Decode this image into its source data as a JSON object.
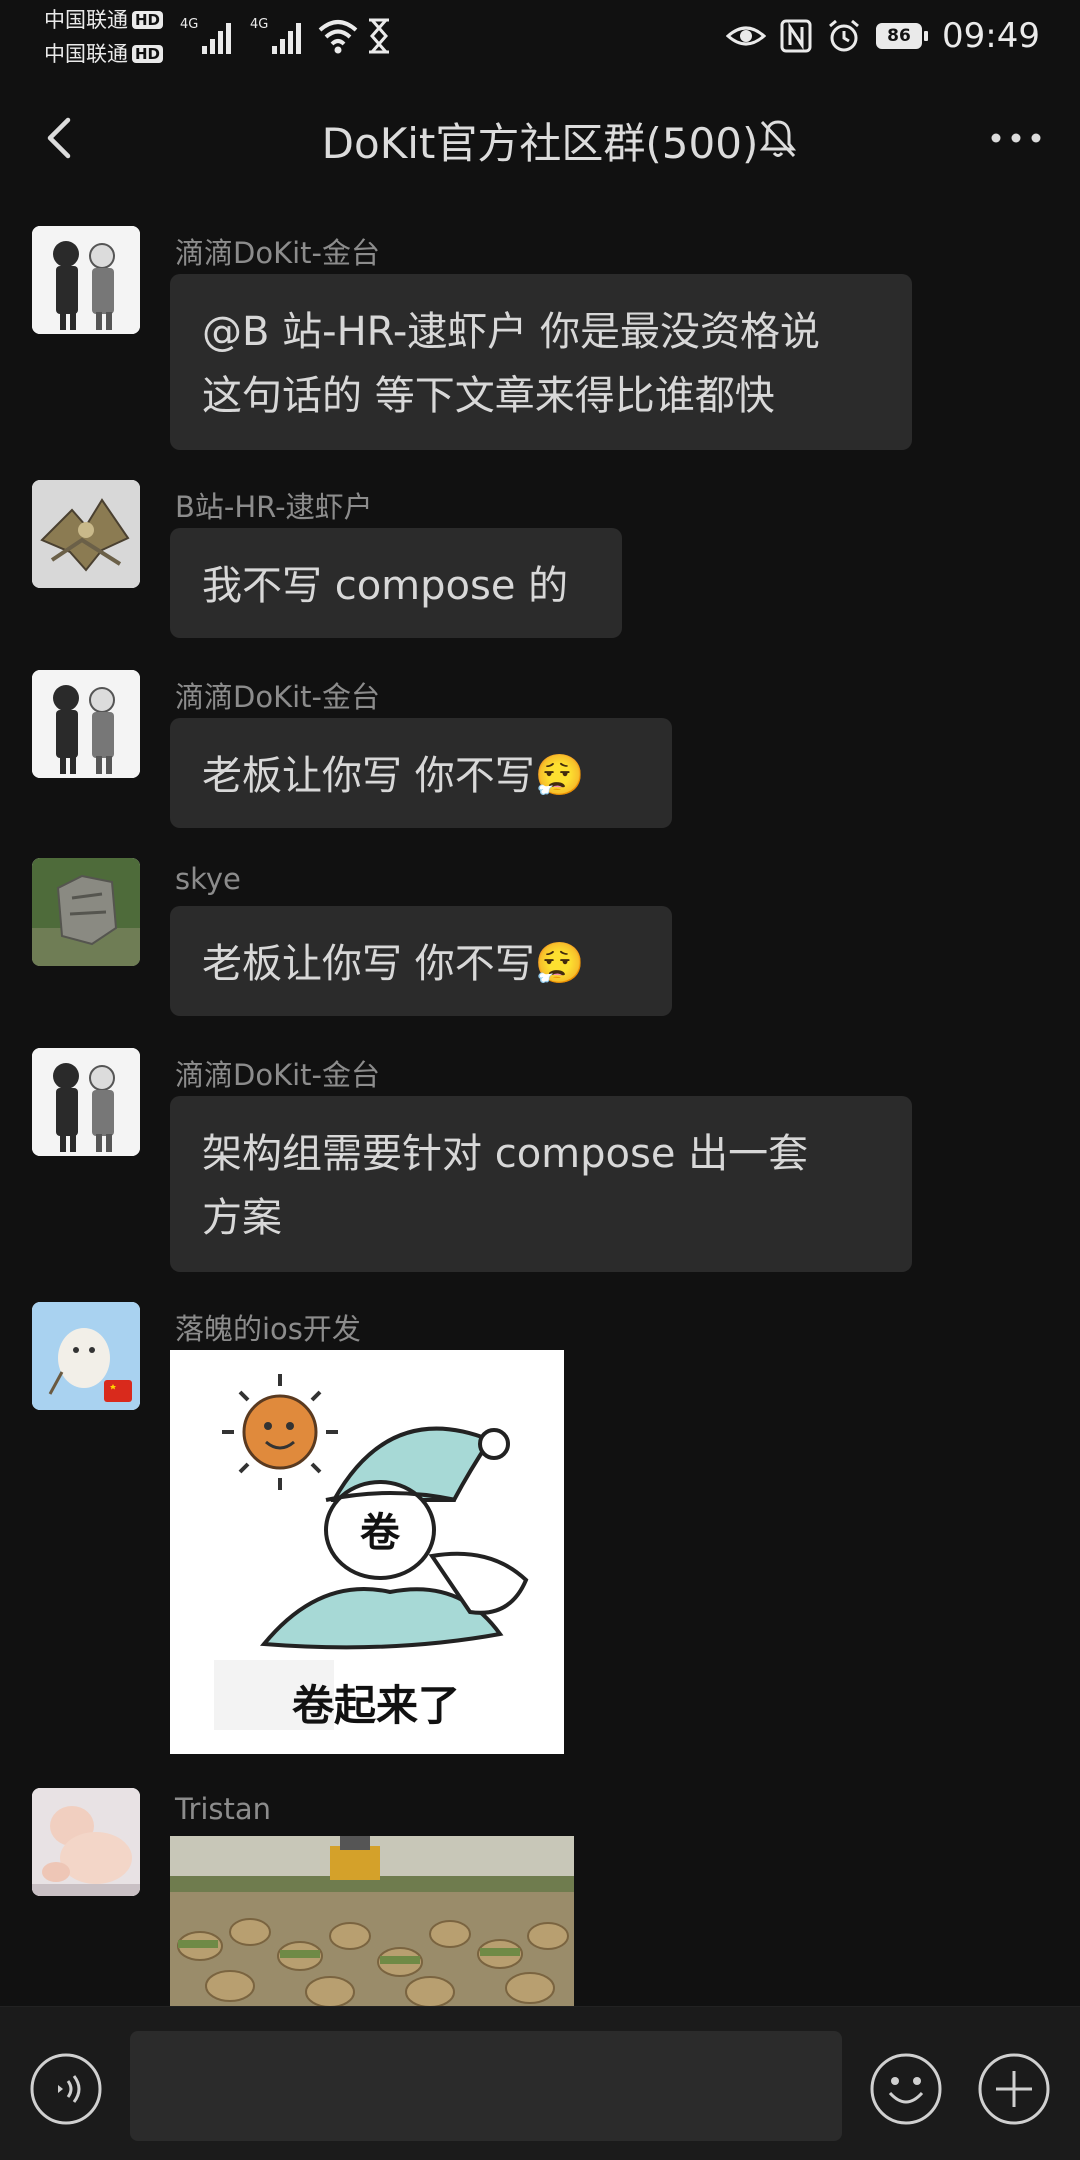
{
  "status_bar": {
    "carrier1": "中国联通",
    "carrier2": "中国联通",
    "hd_label": "HD",
    "signal_label": "4G",
    "battery": "86",
    "time": "09:49"
  },
  "header": {
    "title": "DoKit官方社区群(500)"
  },
  "messages": [
    {
      "sender": "滴滴DoKit-金台",
      "line1": "@B 站-HR-逮虾户  你是最没资格说",
      "line2": "这句话的 等下文章来得比谁都快"
    },
    {
      "sender": "B站-HR-逮虾户",
      "line1": "我不写 compose 的"
    },
    {
      "sender": "滴滴DoKit-金台",
      "line1": "老板让你写 你不写",
      "emoji": "😮‍💨"
    },
    {
      "sender": "skye",
      "line1": "老板让你写 你不写",
      "emoji": "😮‍💨"
    },
    {
      "sender": "滴滴DoKit-金台",
      "line1": "架构组需要针对 compose 出一套",
      "line2": "方案"
    },
    {
      "sender": "落魄的ios开发",
      "sticker_char": "卷",
      "sticker_caption": "卷起来了"
    },
    {
      "sender": "Tristan"
    }
  ],
  "input_bar": {
    "placeholder": ""
  },
  "icons": {
    "back": "chevron-left-icon",
    "mute": "bell-off-icon",
    "more": "more-dots-icon",
    "voice": "voice-icon",
    "emoji": "emoji-icon",
    "plus": "plus-icon"
  },
  "colors": {
    "background": "#111111",
    "bubble": "#2b2b2b",
    "sender_text": "#8c8c8c",
    "message_text": "#d8d8d8"
  }
}
